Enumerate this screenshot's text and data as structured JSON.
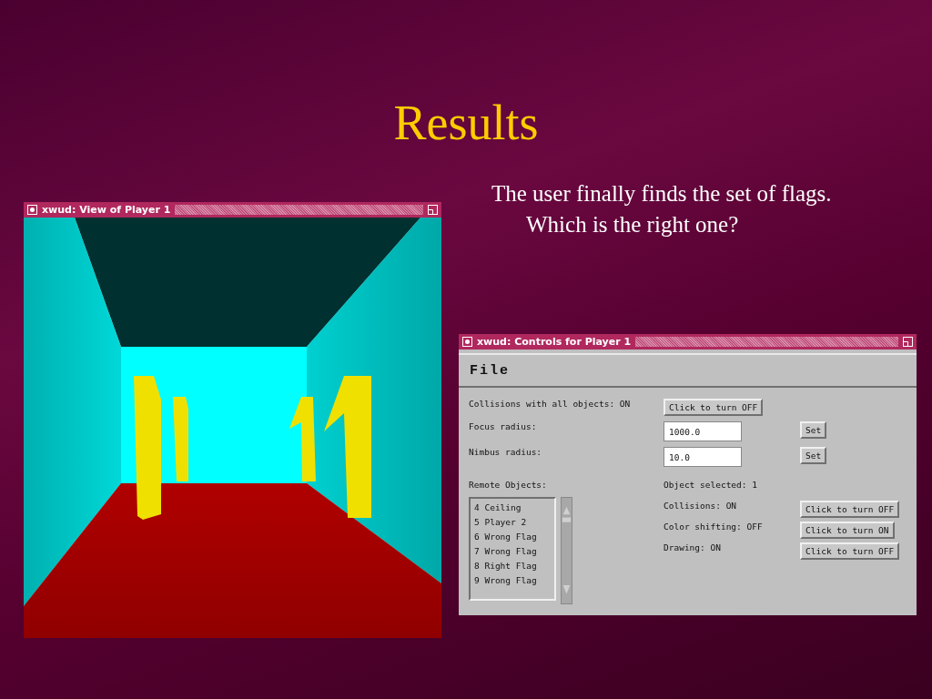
{
  "slide": {
    "title": "Results",
    "text": "The user finally finds the set of flags. Which is the right one?"
  },
  "view_window": {
    "title": "xwud: View of Player 1"
  },
  "controls_window": {
    "title": "xwud: Controls for Player 1",
    "menu": [
      "File"
    ],
    "settings": [
      {
        "label": "Collisions with all objects: ON",
        "kind": "toggle",
        "button": "Click to turn OFF"
      },
      {
        "label": "Focus radius:",
        "kind": "field",
        "value": "1000.0",
        "button": "Set"
      },
      {
        "label": "Nimbus radius:",
        "kind": "field",
        "value": "10.0",
        "button": "Set"
      }
    ],
    "list_label": "Remote Objects:",
    "objects": [
      "4 Ceiling",
      "5 Player 2",
      "6 Wrong Flag",
      "7 Wrong Flag",
      "8 Right Flag",
      "9 Wrong Flag"
    ],
    "selected_label": "Object selected: 1",
    "object_settings": [
      {
        "label": "Collisions: ON",
        "button": "Click to turn OFF"
      },
      {
        "label": "Color shifting: OFF",
        "button": "Click to turn ON"
      },
      {
        "label": "Drawing: ON",
        "button": "Click to turn OFF"
      }
    ]
  }
}
